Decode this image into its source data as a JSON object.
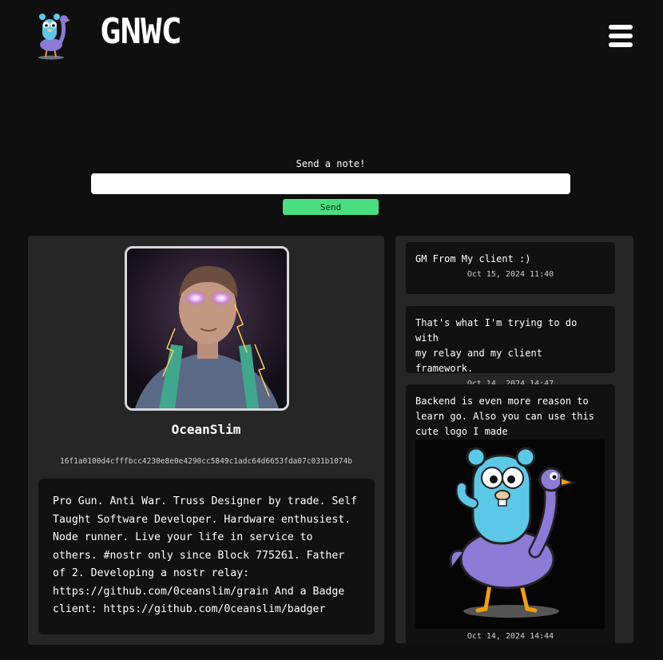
{
  "header": {
    "brand": "GNWC",
    "logo_icon": "gopher-ostrich-logo-icon",
    "menu_icon": "hamburger-menu-icon"
  },
  "compose": {
    "label": "Send a note!",
    "input_value": "",
    "send_label": "Send"
  },
  "profile": {
    "name": "OceanSlim",
    "pubkey": "16f1a0100d4cfffbcc4230e8e0e4290cc5849c1adc64d6653fda07c031b1074b",
    "about": "Pro Gun. Anti War. Truss Designer by trade. Self\nTaught Software Developer. Hardware enthusiest.\nNode runner. Live your life in service to\nothers. #nostr only since Block 775261. Father\nof 2. Developing a nostr relay:\nhttps://github.com/0ceanslim/grain And a Badge\nclient: https://github.com/0ceanslim/badger"
  },
  "notes": [
    {
      "text": "GM From My client :)",
      "time": "Oct 15, 2024 11:40"
    },
    {
      "text": "That's what I'm trying to do with\nmy relay and my client framework.",
      "time": "Oct 14, 2024 14:47"
    },
    {
      "text": "Backend is even more reason to\nlearn go. Also you can use this\ncute logo I made",
      "time": "Oct 14, 2024 14:44"
    }
  ],
  "colors": {
    "background": "#0f0f0f",
    "panel": "#262626",
    "card": "#111111",
    "send_button": "#4ade80"
  }
}
